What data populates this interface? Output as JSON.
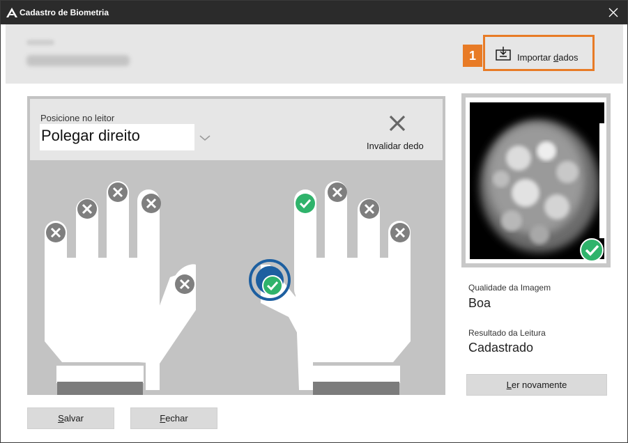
{
  "window": {
    "title": "Cadastro de Biometria"
  },
  "header": {
    "import_badge": "1",
    "import_label_pre": "Importar ",
    "import_label_u": "d",
    "import_label_post": "ados"
  },
  "selector": {
    "label": "Posicione no leitor",
    "value": "Polegar direito",
    "invalidate_label": "Invalidar dedo"
  },
  "fingers": {
    "left_hand": [
      "invalid",
      "invalid",
      "invalid",
      "invalid",
      "invalid"
    ],
    "right_hand": [
      "valid",
      "invalid",
      "invalid",
      "invalid"
    ],
    "right_thumb": "valid-selected"
  },
  "result": {
    "quality_label": "Qualidade da Imagem",
    "quality_value": "Boa",
    "read_label": "Resultado da Leitura",
    "read_value": "Cadastrado",
    "reread_u": "L",
    "reread_rest": "er novamente"
  },
  "footer": {
    "save_u": "S",
    "save_rest": "alvar",
    "close_u": "F",
    "close_rest": "echar"
  },
  "colors": {
    "accent": "#e87b26",
    "valid": "#2fb36b",
    "invalid": "#7f7f7f",
    "selected_ring": "#1d5fa0"
  }
}
